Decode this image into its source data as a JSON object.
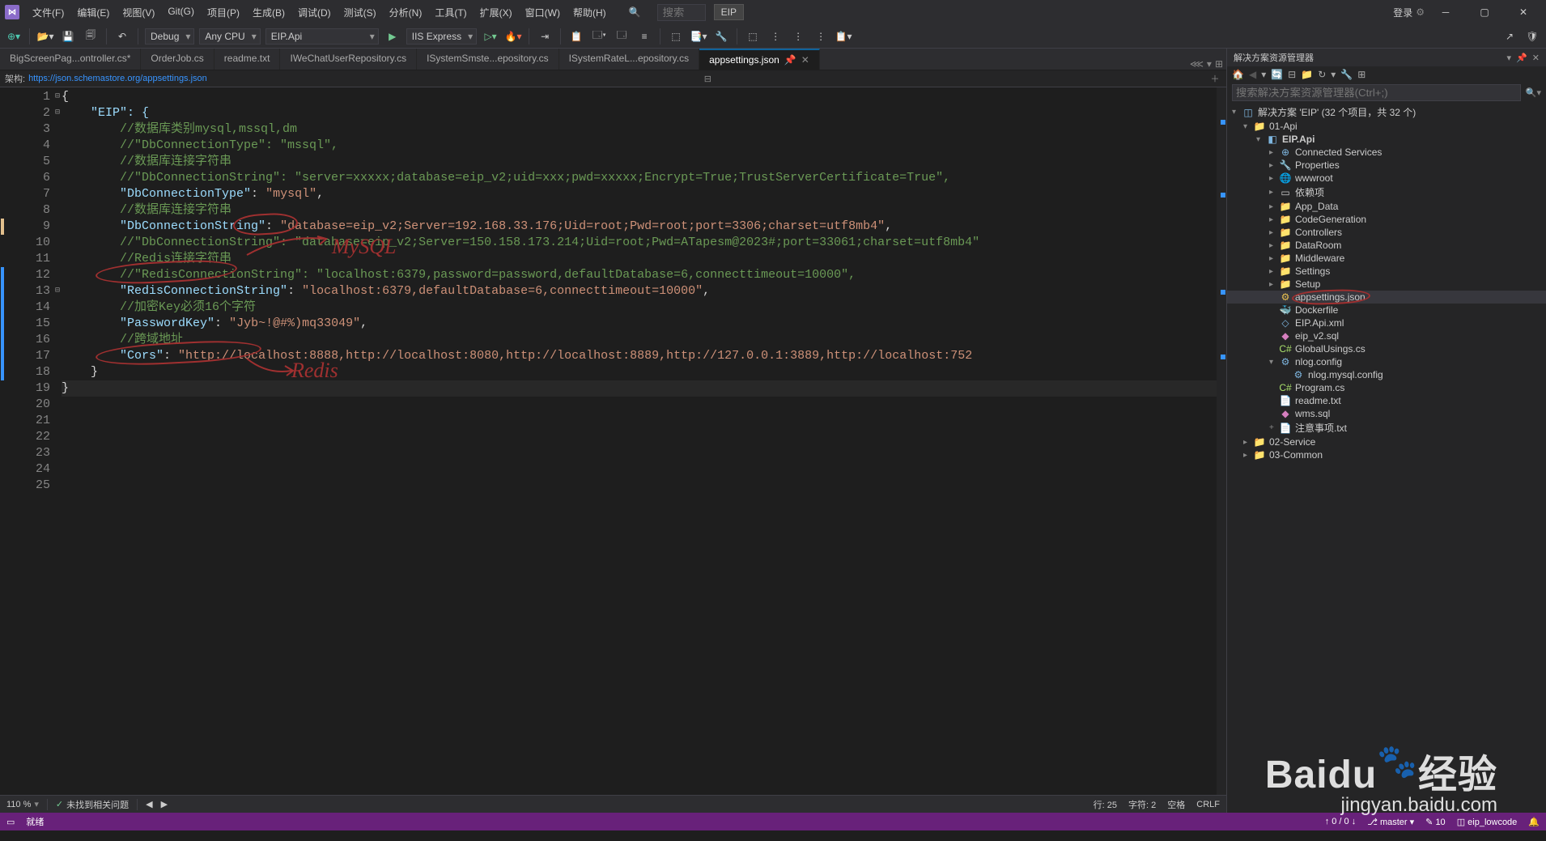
{
  "titlebar": {
    "menus": [
      "文件(F)",
      "编辑(E)",
      "视图(V)",
      "Git(G)",
      "项目(P)",
      "生成(B)",
      "调试(D)",
      "测试(S)",
      "分析(N)",
      "工具(T)",
      "扩展(X)",
      "窗口(W)",
      "帮助(H)"
    ],
    "search_icon": "🔍",
    "search_placeholder": "搜索",
    "eip_label": "EIP",
    "login_label": "登录",
    "settings_icon": "⚙"
  },
  "toolbar": {
    "config": "Debug",
    "platform": "Any CPU",
    "startup": "EIP.Api",
    "run": "IIS Express"
  },
  "tabs": [
    {
      "label": "BigScreenPag...ontroller.cs",
      "dirty": true,
      "active": false
    },
    {
      "label": "OrderJob.cs",
      "dirty": false,
      "active": false
    },
    {
      "label": "readme.txt",
      "dirty": false,
      "active": false
    },
    {
      "label": "IWeChatUserRepository.cs",
      "dirty": false,
      "active": false
    },
    {
      "label": "ISystemSmste...epository.cs",
      "dirty": false,
      "active": false
    },
    {
      "label": "ISystemRateL...epository.cs",
      "dirty": false,
      "active": false
    },
    {
      "label": "appsettings.json",
      "dirty": false,
      "active": true,
      "pinned": true
    }
  ],
  "schema": {
    "label": "架构:",
    "url": "https://json.schemastore.org/appsettings.json"
  },
  "code": {
    "lines": [
      {
        "n": 1,
        "fold": "⊟",
        "segs": [
          {
            "t": "{",
            "c": "brace"
          }
        ]
      },
      {
        "n": 2,
        "fold": "⊟",
        "segs": [
          {
            "t": "    \"EIP\": {",
            "c": "key-brace"
          }
        ]
      },
      {
        "n": 3,
        "fold": "",
        "segs": [
          {
            "t": "        //数据库类别mysql,mssql,dm",
            "c": "green"
          }
        ]
      },
      {
        "n": 4,
        "fold": "",
        "segs": [
          {
            "t": "        //\"DbConnectionType\": \"mssql\",",
            "c": "green"
          }
        ]
      },
      {
        "n": 5,
        "fold": "",
        "segs": [
          {
            "t": "",
            "c": "brace"
          }
        ]
      },
      {
        "n": 6,
        "fold": "",
        "segs": [
          {
            "t": "        //数据库连接字符串",
            "c": "green"
          }
        ]
      },
      {
        "n": 7,
        "fold": "",
        "segs": [
          {
            "t": "        //\"DbConnectionString\": \"server=xxxxx;database=eip_v2;uid=xxx;pwd=xxxxx;Encrypt=True;TrustServerCertificate=True\",",
            "c": "green"
          }
        ]
      },
      {
        "n": 8,
        "fold": "",
        "segs": [
          {
            "t": "",
            "c": "brace"
          }
        ]
      },
      {
        "n": 9,
        "fold": "",
        "mark": "orange",
        "segs": [
          {
            "t": "        ",
            "c": "brace"
          },
          {
            "t": "\"DbConnectionType\"",
            "c": "key"
          },
          {
            "t": ": ",
            "c": "brace"
          },
          {
            "t": "\"mysql\"",
            "c": "str"
          },
          {
            "t": ",",
            "c": "brace"
          }
        ]
      },
      {
        "n": 10,
        "fold": "",
        "segs": [
          {
            "t": "",
            "c": "brace"
          }
        ]
      },
      {
        "n": 11,
        "fold": "",
        "segs": [
          {
            "t": "        //数据库连接字符串",
            "c": "green"
          }
        ]
      },
      {
        "n": 12,
        "fold": "",
        "mark": "blue",
        "segs": [
          {
            "t": "        ",
            "c": "brace"
          },
          {
            "t": "\"DbConnectionString\"",
            "c": "key"
          },
          {
            "t": ": ",
            "c": "brace"
          },
          {
            "t": "\"database=eip_v2;Server=192.168.33.176;Uid=root;Pwd=root;port=3306;charset=utf8mb4\"",
            "c": "str"
          },
          {
            "t": ",",
            "c": "brace"
          }
        ]
      },
      {
        "n": 13,
        "fold": "⊟",
        "mark": "blue",
        "segs": [
          {
            "t": "        //\"DbConnectionString\": \"database=eip_v2;Server=150.158.173.214;Uid=root;Pwd=ATapesm@2023#;port=33061;charset=utf8mb4\"",
            "c": "green"
          }
        ]
      },
      {
        "n": 14,
        "fold": "",
        "mark": "blue",
        "segs": [
          {
            "t": "",
            "c": "brace"
          }
        ]
      },
      {
        "n": 15,
        "fold": "",
        "mark": "blue",
        "segs": [
          {
            "t": "        //Redis连接字符串",
            "c": "green"
          }
        ]
      },
      {
        "n": 16,
        "fold": "",
        "mark": "blue",
        "segs": [
          {
            "t": "        //\"RedisConnectionString\": \"localhost:6379,password=password,defaultDatabase=6,connecttimeout=10000\",",
            "c": "green"
          }
        ]
      },
      {
        "n": 17,
        "fold": "",
        "mark": "blue",
        "segs": [
          {
            "t": "        ",
            "c": "brace"
          },
          {
            "t": "\"RedisConnectionString\"",
            "c": "key"
          },
          {
            "t": ": ",
            "c": "brace"
          },
          {
            "t": "\"localhost:6379,defaultDatabase=6,connecttimeout=10000\"",
            "c": "str"
          },
          {
            "t": ",",
            "c": "brace"
          }
        ]
      },
      {
        "n": 18,
        "fold": "",
        "mark": "blue",
        "segs": [
          {
            "t": "",
            "c": "brace"
          }
        ]
      },
      {
        "n": 19,
        "fold": "",
        "segs": [
          {
            "t": "        //加密Key必须16个字符",
            "c": "green"
          }
        ]
      },
      {
        "n": 20,
        "fold": "",
        "segs": [
          {
            "t": "        ",
            "c": "brace"
          },
          {
            "t": "\"PasswordKey\"",
            "c": "key"
          },
          {
            "t": ": ",
            "c": "brace"
          },
          {
            "t": "\"Jyb~!@#%)mq33049\"",
            "c": "str"
          },
          {
            "t": ",",
            "c": "brace"
          }
        ]
      },
      {
        "n": 21,
        "fold": "",
        "segs": [
          {
            "t": "",
            "c": "brace"
          }
        ]
      },
      {
        "n": 22,
        "fold": "",
        "segs": [
          {
            "t": "        //跨域地址",
            "c": "green"
          }
        ]
      },
      {
        "n": 23,
        "fold": "",
        "segs": [
          {
            "t": "        ",
            "c": "brace"
          },
          {
            "t": "\"Cors\"",
            "c": "key"
          },
          {
            "t": ": ",
            "c": "brace"
          },
          {
            "t": "\"http://localhost:8888,http://localhost:8080,http://localhost:8889,http://127.0.0.1:3889,http://localhost:752",
            "c": "str"
          }
        ]
      },
      {
        "n": 24,
        "fold": "",
        "segs": [
          {
            "t": "    }",
            "c": "brace"
          }
        ]
      },
      {
        "n": 25,
        "fold": "",
        "current": true,
        "segs": [
          {
            "t": "}",
            "c": "brace"
          }
        ]
      }
    ]
  },
  "annotations": {
    "mysql": "MySQL",
    "redis": "Redis"
  },
  "doc_status": {
    "zoom": "110 %",
    "issues": "未找到相关问题",
    "nav_prev": "◀",
    "nav_next": "▶",
    "line": "行: 25",
    "col": "字符: 2",
    "space": "空格",
    "eol": "CRLF"
  },
  "explorer": {
    "title": "解决方案资源管理器",
    "search_placeholder": "搜索解决方案资源管理器(Ctrl+;)",
    "root": "解决方案 'EIP' (32 个项目，共 32 个)"
  },
  "tree": [
    {
      "depth": 0,
      "exp": "▾",
      "ic": "📁",
      "cls": "ic-folder",
      "lbl": "01-Api"
    },
    {
      "depth": 1,
      "exp": "▾",
      "ic": "◧",
      "cls": "ic-proj",
      "lbl": "EIP.Api",
      "bold": true
    },
    {
      "depth": 2,
      "exp": "▸",
      "ic": "⊕",
      "cls": "ic-globe",
      "lbl": "Connected Services"
    },
    {
      "depth": 2,
      "exp": "▸",
      "ic": "🔧",
      "cls": "ic-config",
      "lbl": "Properties"
    },
    {
      "depth": 2,
      "exp": "▸",
      "ic": "🌐",
      "cls": "ic-globe",
      "lbl": "wwwroot"
    },
    {
      "depth": 2,
      "exp": "▸",
      "ic": "▭",
      "cls": "ic-txt",
      "lbl": "依赖项"
    },
    {
      "depth": 2,
      "exp": "▸",
      "ic": "📁",
      "cls": "ic-folder",
      "lbl": "App_Data"
    },
    {
      "depth": 2,
      "exp": "▸",
      "ic": "📁",
      "cls": "ic-folder",
      "lbl": "CodeGeneration"
    },
    {
      "depth": 2,
      "exp": "▸",
      "ic": "📁",
      "cls": "ic-folder",
      "lbl": "Controllers"
    },
    {
      "depth": 2,
      "exp": "▸",
      "ic": "📁",
      "cls": "ic-folder",
      "lbl": "DataRoom"
    },
    {
      "depth": 2,
      "exp": "▸",
      "ic": "📁",
      "cls": "ic-folder",
      "lbl": "Middleware"
    },
    {
      "depth": 2,
      "exp": "▸",
      "ic": "📁",
      "cls": "ic-folder",
      "lbl": "Settings"
    },
    {
      "depth": 2,
      "exp": "▸",
      "ic": "📁",
      "cls": "ic-folder",
      "lbl": "Setup"
    },
    {
      "depth": 2,
      "exp": " ",
      "ic": "⚙",
      "cls": "ic-json",
      "lbl": "appsettings.json",
      "selected": true,
      "circled": true
    },
    {
      "depth": 2,
      "exp": " ",
      "ic": "🐳",
      "cls": "ic-dock",
      "lbl": "Dockerfile"
    },
    {
      "depth": 2,
      "exp": " ",
      "ic": "◇",
      "cls": "ic-xml",
      "lbl": "EIP.Api.xml"
    },
    {
      "depth": 2,
      "exp": " ",
      "ic": "◆",
      "cls": "ic-sql",
      "lbl": "eip_v2.sql"
    },
    {
      "depth": 2,
      "exp": " ",
      "ic": "C#",
      "cls": "ic-csharp",
      "lbl": "GlobalUsings.cs"
    },
    {
      "depth": 2,
      "exp": "▾",
      "ic": "⚙",
      "cls": "ic-config",
      "lbl": "nlog.config"
    },
    {
      "depth": 3,
      "exp": " ",
      "ic": "⚙",
      "cls": "ic-config",
      "lbl": "nlog.mysql.config"
    },
    {
      "depth": 2,
      "exp": " ",
      "ic": "C#",
      "cls": "ic-csharp",
      "lbl": "Program.cs"
    },
    {
      "depth": 2,
      "exp": " ",
      "ic": "📄",
      "cls": "ic-txt",
      "lbl": "readme.txt"
    },
    {
      "depth": 2,
      "exp": " ",
      "ic": "◆",
      "cls": "ic-sql",
      "lbl": "wms.sql"
    },
    {
      "depth": 2,
      "exp": "+",
      "ic": "📄",
      "cls": "ic-txt",
      "lbl": "注意事项.txt"
    },
    {
      "depth": 0,
      "exp": "▸",
      "ic": "📁",
      "cls": "ic-folder",
      "lbl": "02-Service"
    },
    {
      "depth": 0,
      "exp": "▸",
      "ic": "📁",
      "cls": "ic-folder",
      "lbl": "03-Common"
    }
  ],
  "statusbar": {
    "ready": "就绪",
    "vc_up": "↑ 0 / 0 ↓",
    "branch": "master",
    "pencil": "10",
    "repo": "eip_lowcode"
  },
  "watermark": {
    "brand": "Baidu",
    "suffix": "经验",
    "sub": "jingyan.baidu.com"
  }
}
